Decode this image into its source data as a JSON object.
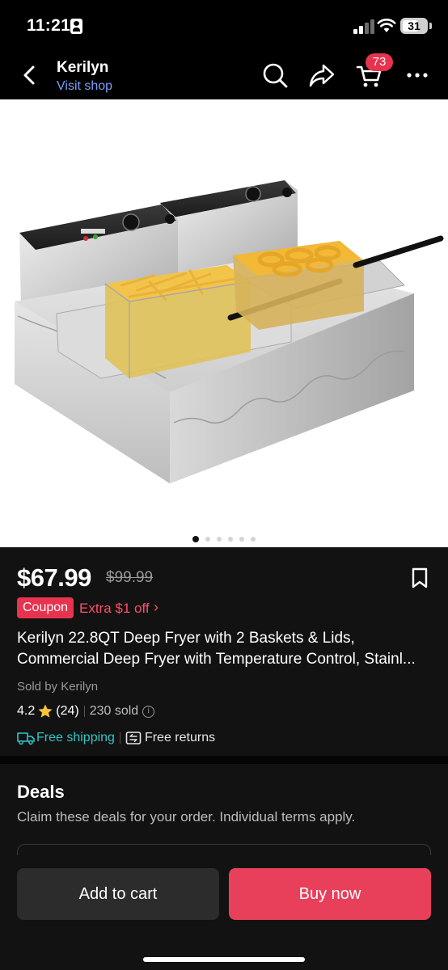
{
  "status_bar": {
    "time": "11:21",
    "battery": "31"
  },
  "nav": {
    "shop_name": "Kerilyn",
    "visit_shop": "Visit shop",
    "cart_count": "73"
  },
  "image": {
    "slide_count": 6,
    "active_slide": 1
  },
  "product": {
    "price": "$67.99",
    "original_price": "$99.99",
    "coupon_label": "Coupon",
    "coupon_text": "Extra $1 off",
    "coupon_chevron": "›",
    "title_line1": "Kerilyn 22.8QT Deep Fryer with 2 Baskets & Lids,",
    "title_line2": "Commercial Deep Fryer with Temperature Control, Stainl...",
    "sold_by": "Sold by Kerilyn",
    "rating": "4.2",
    "reviews": "(24)",
    "sold": "230 sold",
    "free_shipping": "Free shipping",
    "free_returns": "Free returns"
  },
  "deals": {
    "title": "Deals",
    "subtitle": "Claim these deals for your order. Individual terms apply."
  },
  "actions": {
    "add_to_cart": "Add to cart",
    "buy_now": "Buy now"
  },
  "colors": {
    "accent_red": "#e8334f",
    "link_blue": "#7d9ef8",
    "shipping_teal": "#2fc7c7"
  }
}
